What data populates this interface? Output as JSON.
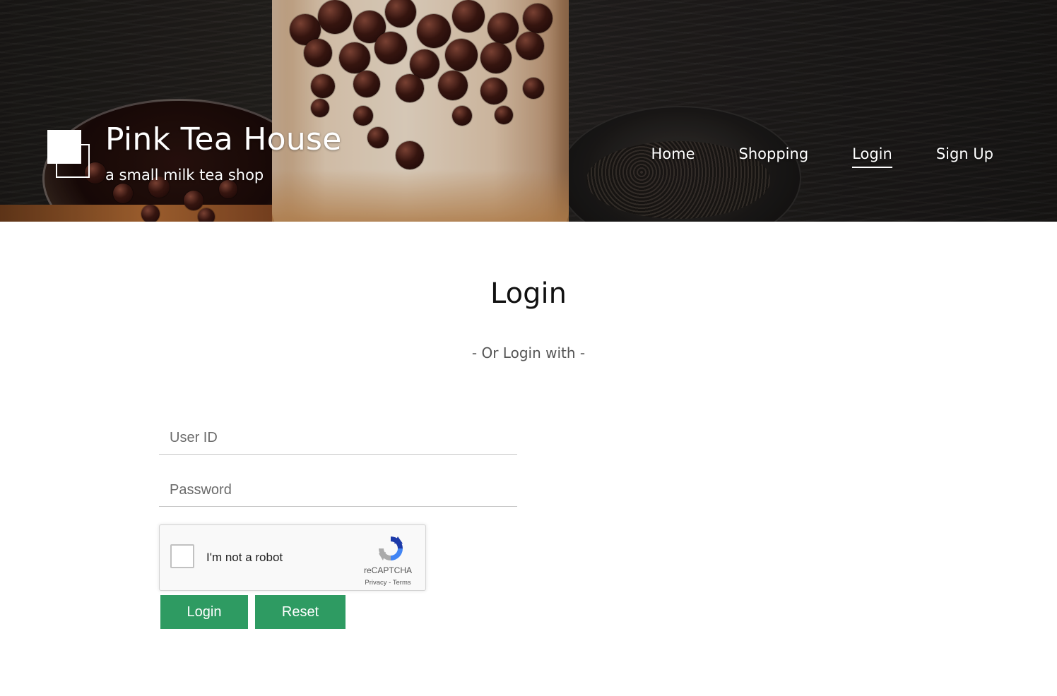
{
  "brand": {
    "title": "Pink Tea House",
    "subtitle": "a small milk tea shop",
    "logo_icon": "overlapping-squares-logo"
  },
  "nav": {
    "items": [
      {
        "label": "Home",
        "active": false
      },
      {
        "label": "Shopping",
        "active": false
      },
      {
        "label": "Login",
        "active": true
      },
      {
        "label": "Sign Up",
        "active": false
      }
    ]
  },
  "main": {
    "title": "Login",
    "alt_login_text": "- Or Login with -",
    "user_id_placeholder": "User ID",
    "password_placeholder": "Password",
    "user_id_value": "",
    "password_value": ""
  },
  "captcha": {
    "label": "I'm not a robot",
    "brand": "reCAPTCHA",
    "links": "Privacy - Terms",
    "checked": false,
    "icon": "recaptcha-icon"
  },
  "buttons": {
    "login": "Login",
    "reset": "Reset"
  },
  "colors": {
    "button_green": "#2e9b62",
    "hero_dark": "#1d1b19"
  }
}
